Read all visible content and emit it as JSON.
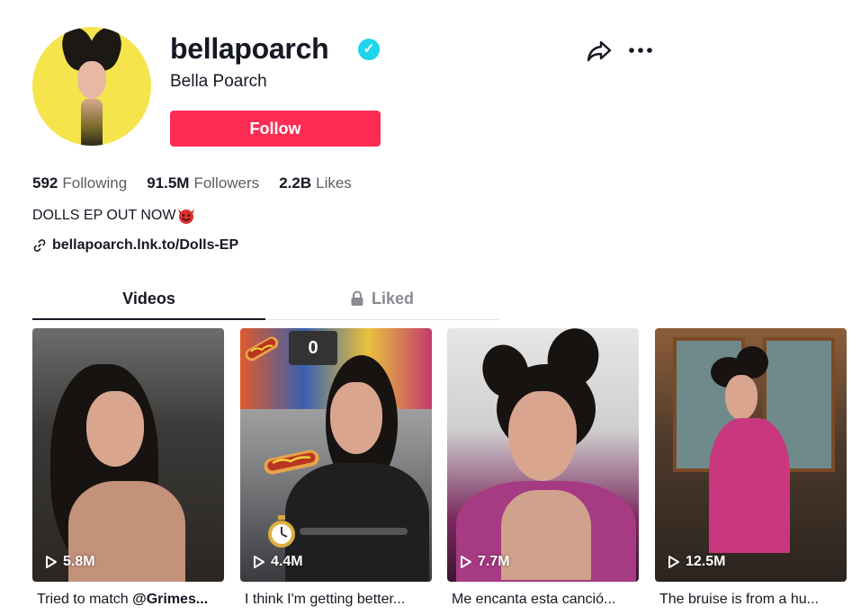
{
  "profile": {
    "username": "bellapoarch",
    "nickname": "Bella Poarch",
    "follow_label": "Follow",
    "verified_icon": "verified-check-icon",
    "bio": "DOLLS EP OUT NOW",
    "link": "bellapoarch.lnk.to/Dolls-EP"
  },
  "stats": [
    {
      "value": "592",
      "label": "Following"
    },
    {
      "value": "91.5M",
      "label": "Followers"
    },
    {
      "value": "2.2B",
      "label": "Likes"
    }
  ],
  "tabs": [
    {
      "label": "Videos",
      "active": true
    },
    {
      "label": "Liked",
      "active": false,
      "icon": "lock-icon"
    }
  ],
  "videos": [
    {
      "views": "5.8M",
      "caption_pre": "Tried to match ",
      "caption_bold": "@Grimes..."
    },
    {
      "views": "4.4M",
      "caption_pre": "I think I'm getting better...",
      "caption_bold": "",
      "overlay_count": "0"
    },
    {
      "views": "7.7M",
      "caption_pre": "Me encanta esta canció...",
      "caption_bold": ""
    },
    {
      "views": "12.5M",
      "caption_pre": "The bruise is from a hu...",
      "caption_bold": ""
    }
  ],
  "colors": {
    "accent": "#fe2c55",
    "verified": "#20d5ec",
    "text": "#161823",
    "muted": "#5c5d64"
  }
}
